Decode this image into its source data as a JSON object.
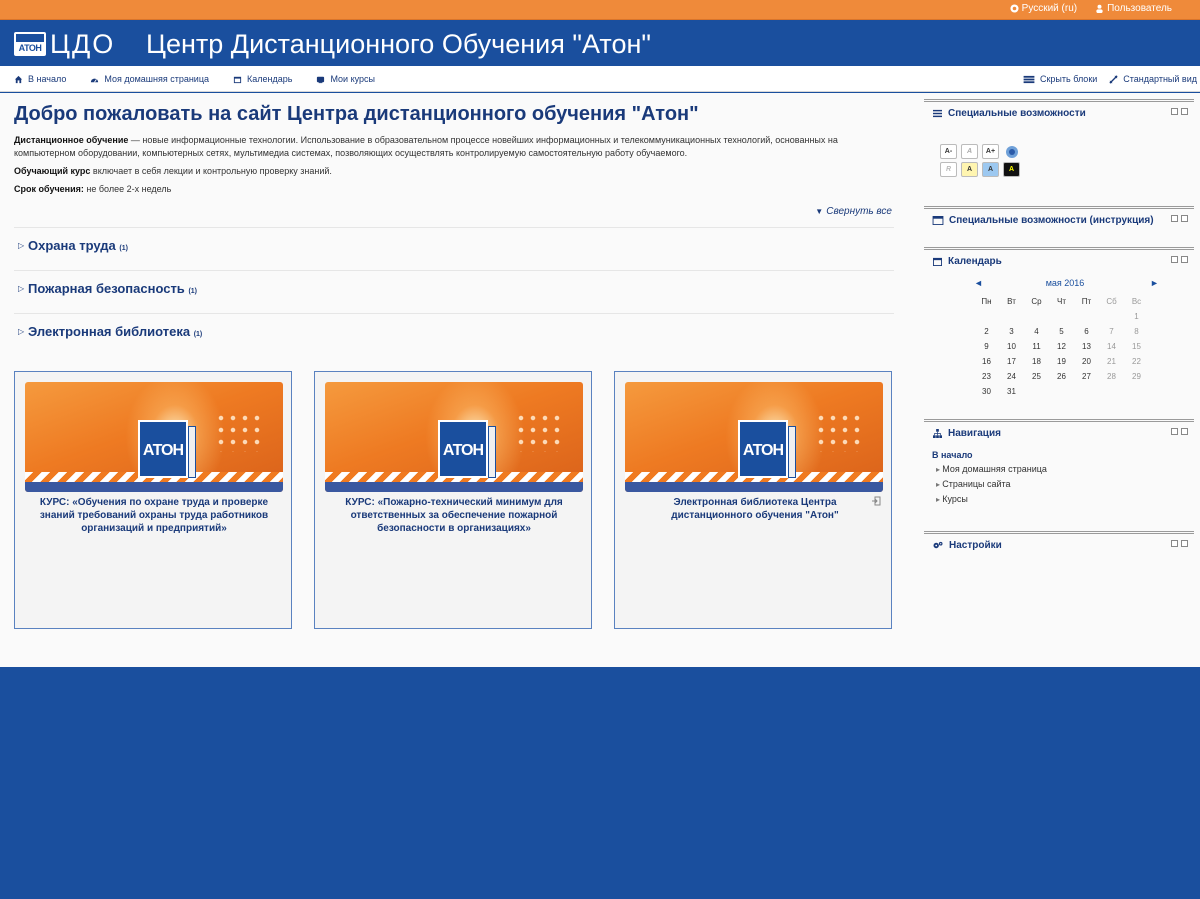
{
  "topbar": {
    "language": "Русский (ru)",
    "user": "Пользователь"
  },
  "header": {
    "logo_text": "АТОН",
    "brand": "ЦДО",
    "title": "Центр Дистанционного Обучения \"Атон\""
  },
  "nav": {
    "items": [
      {
        "label": "В начало",
        "icon": "home-icon"
      },
      {
        "label": "Моя домашняя страница",
        "icon": "dashboard-icon"
      },
      {
        "label": "Календарь",
        "icon": "calendar-icon"
      },
      {
        "label": "Мои курсы",
        "icon": "courses-icon"
      }
    ],
    "hide_blocks": "Скрыть блоки",
    "standard_view": "Стандартный вид"
  },
  "main": {
    "heading": "Добро пожаловать на сайт Центра дистанционного обучения \"Атон\"",
    "intro": {
      "p1_bold": "Дистанционное обучение",
      "p1_text": " — новые информационные технологии. Использование в образовательном процессе новейших информационных и телекоммуникационных технологий, основанных на компьютерном оборудовании, компьютерных сетях, мультимедиа системах, позволяющих осуществлять контролируемую самостоятельную работу обучаемого.",
      "p2_bold": "Обучающий курс",
      "p2_text": " включает в себя лекции  и контрольную проверку знаний.",
      "p3_bold": "Срок обучения:",
      "p3_text": " не более 2-х недель"
    },
    "collapse_all": "Свернуть все",
    "categories": [
      {
        "name": "Охрана труда",
        "count": "(1)"
      },
      {
        "name": "Пожарная безопасность",
        "count": "(1)"
      },
      {
        "name": "Электронная библиотека",
        "count": "(1)"
      }
    ],
    "cards": [
      {
        "banner_text": "АТОН",
        "title": "КУРС: «Обучения по охране труда и проверке знаний требований охраны труда работников организаций и предприятий»"
      },
      {
        "banner_text": "АТОН",
        "title": "КУРС: «Пожарно-технический минимум для ответственных за обеспечение пожарной безопасности в организациях»"
      },
      {
        "banner_text": "АТОН",
        "title": "Электронная библиотека Центра дистанционного обучения \"Атон\""
      }
    ]
  },
  "sidebar": {
    "accessibility": {
      "title": "Специальные возможности",
      "buttons_row1": [
        "A-",
        "A",
        "A+",
        ""
      ],
      "buttons_row2": [
        "R",
        "A",
        "A",
        "A"
      ]
    },
    "accessibility_help": {
      "title": "Специальные возможности (инструкция)"
    },
    "calendar": {
      "title": "Календарь",
      "month": "мая 2016",
      "prev": "◄",
      "next": "►",
      "weekdays": [
        "Пн",
        "Вт",
        "Ср",
        "Чт",
        "Пт",
        "Сб",
        "Вс"
      ],
      "weeks": [
        [
          "",
          "",
          "",
          "",
          "",
          "",
          "1"
        ],
        [
          "2",
          "3",
          "4",
          "5",
          "6",
          "7",
          "8"
        ],
        [
          "9",
          "10",
          "11",
          "12",
          "13",
          "14",
          "15"
        ],
        [
          "16",
          "17",
          "18",
          "19",
          "20",
          "21",
          "22"
        ],
        [
          "23",
          "24",
          "25",
          "26",
          "27",
          "28",
          "29"
        ],
        [
          "30",
          "31",
          "",
          "",
          "",
          "",
          ""
        ]
      ]
    },
    "navigation": {
      "title": "Навигация",
      "root": "В начало",
      "items": [
        "Моя домашняя страница",
        "Страницы сайта",
        "Курсы"
      ]
    },
    "settings": {
      "title": "Настройки"
    }
  },
  "colors": {
    "orange": "#ef8a3a",
    "brand_blue": "#1a4f9e",
    "link_blue": "#1a3a7a"
  }
}
